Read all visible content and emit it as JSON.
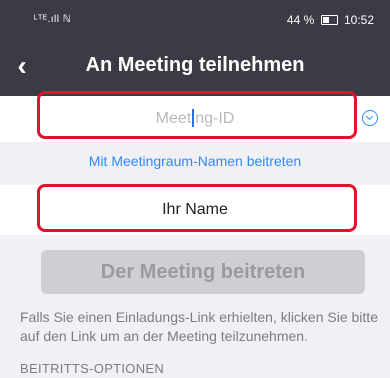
{
  "status_bar": {
    "signal": "ᴸᵀᴱ.ıll ℕ",
    "battery": "44 %",
    "time": "10:52"
  },
  "header": {
    "back_glyph": "‹",
    "title": "An Meeting teilnehmen"
  },
  "meeting_id": {
    "placeholder_left": "Meet",
    "placeholder_right": "ng-ID"
  },
  "room_name_link": "Mit Meetingraum-Namen beitreten",
  "name_field": {
    "value": "Ihr Name"
  },
  "join_button": "Der Meeting beitreten",
  "hint_text": "Falls Sie einen Einladungs-Link erhielten, klicken Sie bitte auf den Link um an der Meeting teilzunehmen.",
  "options_heading": "BEITRITTS-OPTIONEN",
  "colors": {
    "topbar": "#3b3b46",
    "accent": "#2d8cff",
    "highlight": "#e0122c",
    "disabled_button": "#cfcfd3"
  },
  "icons": {
    "back": "chevron-left-icon",
    "dropdown": "chevron-down-circle-icon",
    "battery": "battery-icon"
  }
}
